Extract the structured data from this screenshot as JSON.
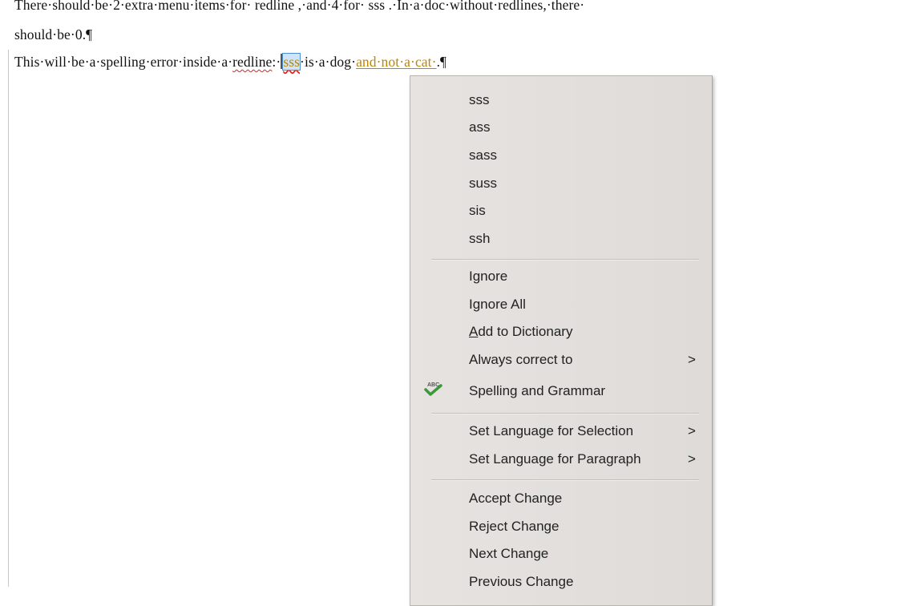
{
  "document": {
    "line1": "There·should·be·2·extra·menu·items·for· redline ,·and·4·for· sss .·In·a·doc·without·redlines,·there·",
    "line2": "should·be·0.¶",
    "line3_before": "This·will·be·a·spelling·error·inside·a·",
    "line3_squiggle": "redline",
    "line3_colon": ":·",
    "line3_selected": "sss",
    "line3_mid": "·is·a·dog·",
    "line3_redline": "and·not·a·cat·",
    "line3_end": ".¶"
  },
  "context_menu": {
    "suggestions": [
      "sss",
      "ass",
      "sass",
      "suss",
      "sis",
      "ssh"
    ],
    "ignore": "Ignore",
    "ignore_all": "Ignore All",
    "add_to_dictionary_accel": "A",
    "add_to_dictionary_rest": "dd to Dictionary",
    "always_correct_to": "Always correct to",
    "spelling_and_grammar": "Spelling and Grammar",
    "set_language_selection": "Set Language for Selection",
    "set_language_paragraph": "Set Language for Paragraph",
    "accept_change": "Accept Change",
    "reject_change": "Reject Change",
    "next_change": "Next Change",
    "previous_change": "Previous Change",
    "submenu_arrow": ">",
    "icons": {
      "spelling": "spelling-check-icon"
    }
  },
  "colors": {
    "redline": "#b8860b",
    "squiggle": "#dd2222",
    "selection": "#cfe4f6",
    "menu_bg": "#e2dfdc"
  }
}
